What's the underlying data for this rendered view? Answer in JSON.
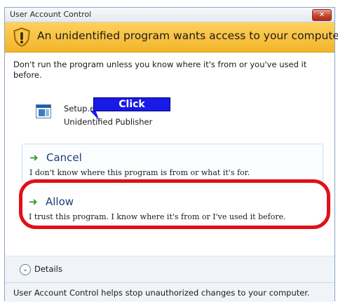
{
  "window": {
    "title": "User Account Control",
    "close_label": "✕"
  },
  "banner": {
    "headline": "An unidentified program wants access to your computer"
  },
  "intro": "Don't run the program unless you know where it's from or you've used it before.",
  "program": {
    "name": "Setup.exe",
    "publisher": "Unidentified Publisher"
  },
  "options": {
    "cancel": {
      "title": "Cancel",
      "description": "I don't know where this program is from or what it's for."
    },
    "allow": {
      "title": "Allow",
      "description": "I trust this program. I know where it's from or I've used it before."
    }
  },
  "callout": {
    "text": "Click"
  },
  "details": {
    "label": "Details"
  },
  "footer": {
    "text": "User Account Control helps stop unauthorized changes to your computer."
  },
  "colors": {
    "banner": "#f1b52b",
    "highlight": "#e0101a",
    "callout": "#1a1ae6",
    "arrow": "#2f9a1f"
  }
}
